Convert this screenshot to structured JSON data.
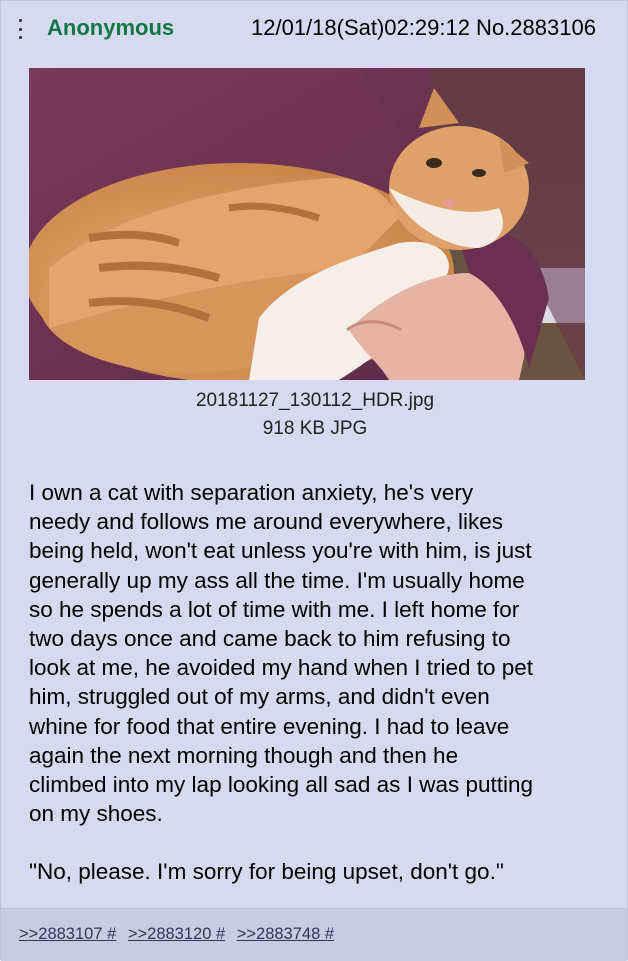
{
  "post": {
    "name": "Anonymous",
    "datetime": "12/01/18(Sat)02:29:12 No.2883106",
    "file": {
      "name": "20181127_130112_HDR.jpg",
      "size": "918 KB JPG",
      "image_description": "orange-and-white-cat-being-held"
    },
    "body": "I own a cat with separation anxiety, he's very\nneedy and follows me around everywhere, likes\nbeing held, won't eat unless you're with him, is just\ngenerally up my ass all the time. I'm usually home\nso he spends a lot of time with me. I left home for\ntwo days once and came back to him refusing to\nlook at me, he avoided my hand when I tried to pet\nhim, struggled out of my arms, and didn't even\nwhine for food that entire evening. I had to leave\nagain the next morning though and then he\nclimbed into my lap looking all sad as I was putting\non my shoes.",
    "quote": "\"No, please. I'm sorry for being upset, don't go.\"",
    "replies": [
      ">>2883107 #",
      ">>2883120 #",
      ">>2883748 #"
    ]
  },
  "colors": {
    "post_bg": "#d6daf0",
    "name": "#117743",
    "link": "#34345c",
    "reply_bar_bg": "#c7cbe4"
  }
}
